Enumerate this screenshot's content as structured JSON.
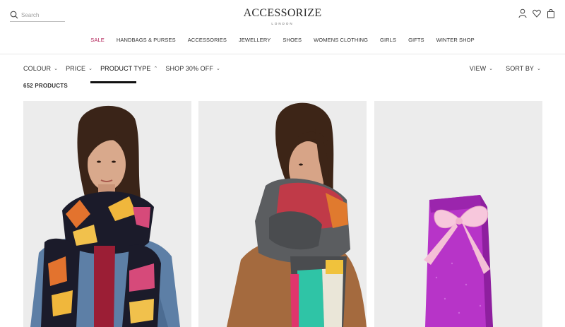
{
  "brand": {
    "name": "ACCESSORIZE",
    "subtitle": "LONDON"
  },
  "search": {
    "placeholder": "Search"
  },
  "header_icons": [
    "search-icon",
    "account-icon",
    "wishlist-heart-icon",
    "shopping-bag-icon"
  ],
  "nav": [
    {
      "label": "SALE",
      "highlight": true
    },
    {
      "label": "HANDBAGS & PURSES"
    },
    {
      "label": "ACCESSORIES"
    },
    {
      "label": "JEWELLERY"
    },
    {
      "label": "SHOES"
    },
    {
      "label": "WOMENS CLOTHING"
    },
    {
      "label": "GIRLS"
    },
    {
      "label": "GIFTS"
    },
    {
      "label": "WINTER SHOP"
    }
  ],
  "filters": [
    {
      "label": "COLOUR"
    },
    {
      "label": "PRICE"
    },
    {
      "label": "PRODUCT TYPE",
      "active": true
    },
    {
      "label": "SHOP 30% OFF"
    }
  ],
  "right_filters": [
    {
      "label": "VIEW"
    },
    {
      "label": "SORT BY"
    }
  ],
  "product_count": "652 PRODUCTS",
  "colors": {
    "sale": "#b3245a",
    "text": "#333333",
    "divider": "#e6e6e6"
  },
  "products": [
    {
      "image": "woman-in-multicolour-scarf-and-denim-jacket"
    },
    {
      "image": "woman-in-grey-colourblock-scarf-and-camel-coat"
    },
    {
      "image": "purple-glitter-gift-bag-with-pink-bow"
    }
  ]
}
